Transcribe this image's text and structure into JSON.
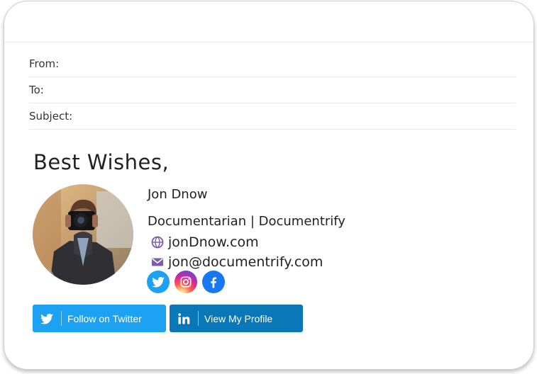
{
  "email_header": {
    "from_label": "From:",
    "to_label": "To:",
    "subject_label": "Subject:"
  },
  "signature": {
    "greeting": "Best Wishes,",
    "name": "Jon Dnow",
    "title": "Documentarian | Documentrify",
    "website": "jonDnow.com",
    "email": "jon@documentrify.com",
    "social_icons": [
      "twitter-icon",
      "instagram-icon",
      "facebook-icon"
    ],
    "buttons": {
      "twitter": "Follow on Twitter",
      "linkedin": "View My Profile"
    }
  },
  "colors": {
    "twitter": "#1da1f2",
    "linkedin": "#0a77b6",
    "facebook": "#1877f2",
    "icon_purple": "#7b5ea7"
  }
}
